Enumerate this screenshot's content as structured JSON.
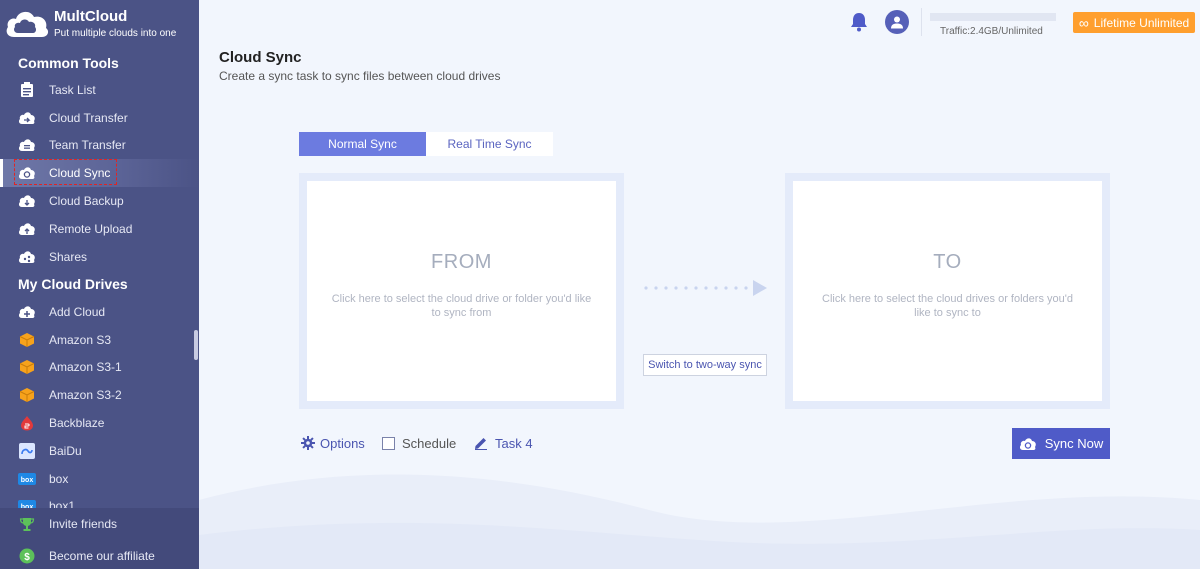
{
  "brand": {
    "name": "MultCloud",
    "tagline": "Put multiple clouds into one"
  },
  "sidebar": {
    "common_tools_title": "Common Tools",
    "common_tools": [
      {
        "label": "Task List",
        "icon": "task-list-icon"
      },
      {
        "label": "Cloud Transfer",
        "icon": "cloud-transfer-icon"
      },
      {
        "label": "Team Transfer",
        "icon": "team-transfer-icon"
      },
      {
        "label": "Cloud Sync",
        "icon": "cloud-sync-icon",
        "active": true
      },
      {
        "label": "Cloud Backup",
        "icon": "cloud-backup-icon"
      },
      {
        "label": "Remote Upload",
        "icon": "remote-upload-icon"
      },
      {
        "label": "Shares",
        "icon": "shares-icon"
      }
    ],
    "my_cloud_drives_title": "My Cloud Drives",
    "drives": [
      {
        "label": "Add Cloud",
        "icon": "add-cloud-icon"
      },
      {
        "label": "Amazon S3",
        "icon": "amazon-s3-icon"
      },
      {
        "label": "Amazon S3-1",
        "icon": "amazon-s3-icon"
      },
      {
        "label": "Amazon S3-2",
        "icon": "amazon-s3-icon"
      },
      {
        "label": "Backblaze",
        "icon": "backblaze-icon"
      },
      {
        "label": "BaiDu",
        "icon": "baidu-icon"
      },
      {
        "label": "box",
        "icon": "box-icon"
      },
      {
        "label": "box1",
        "icon": "box-icon"
      }
    ],
    "bottom": [
      {
        "label": "Invite friends",
        "icon": "trophy-icon"
      },
      {
        "label": "Become our affiliate",
        "icon": "dollar-icon"
      }
    ]
  },
  "header": {
    "traffic": "Traffic:2.4GB/Unlimited",
    "lifetime": "Lifetime Unlimited"
  },
  "page": {
    "title": "Cloud Sync",
    "subtitle": "Create a sync task to sync files between cloud drives"
  },
  "tabs": {
    "normal": "Normal Sync",
    "realtime": "Real Time Sync"
  },
  "from": {
    "title": "FROM",
    "desc": "Click here to select the cloud drive or folder you'd like to sync from"
  },
  "to": {
    "title": "TO",
    "desc": "Click here to select the cloud drives or folders you'd like to sync to"
  },
  "switch_label": "Switch to two-way sync",
  "controls": {
    "options": "Options",
    "schedule": "Schedule",
    "task": "Task 4",
    "sync_now": "Sync Now"
  },
  "colors": {
    "sidebar": "#4b5386",
    "accent": "#4f5bc8",
    "tab_active": "#6c7be0",
    "orange": "#ff9f2e"
  }
}
